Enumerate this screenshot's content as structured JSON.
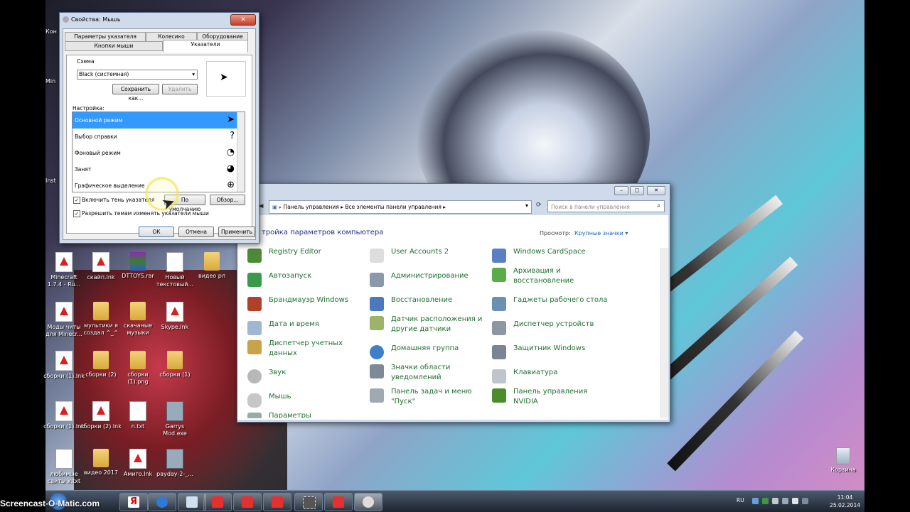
{
  "desktop": {
    "icons": [
      {
        "label": "Minecraft 1.7.4 - Ru...",
        "type": "pdf"
      },
      {
        "label": "скайп.lnk",
        "type": "pdf"
      },
      {
        "label": "DTTOYS.rar",
        "type": "rar"
      },
      {
        "label": "Новый текстовый...",
        "type": "txt"
      },
      {
        "label": "видео рл",
        "type": "folder"
      },
      {
        "label": "Моды читы для Minecr...",
        "type": "pdf"
      },
      {
        "label": "мультики я создал ^_^",
        "type": "folder"
      },
      {
        "label": "скачаные музыки",
        "type": "folder"
      },
      {
        "label": "Skype.lnk",
        "type": "pdf"
      },
      {
        "label": "сборки (1).lnk",
        "type": "pdf"
      },
      {
        "label": "сборки (2)",
        "type": "folder"
      },
      {
        "label": "сборки (1).png",
        "type": "folder"
      },
      {
        "label": "сборки (1)",
        "type": "folder"
      },
      {
        "label": "сборки (1).lnk",
        "type": "pdf"
      },
      {
        "label": "сборки (2).lnk",
        "type": "pdf"
      },
      {
        "label": "n.txt",
        "type": "txt"
      },
      {
        "label": "Garrys Mod.exe",
        "type": "exe"
      },
      {
        "label": "любимые сайты x.txt",
        "type": "txt"
      },
      {
        "label": "видео 2017",
        "type": "folder"
      },
      {
        "label": "Амиго.lnk",
        "type": "pdf"
      },
      {
        "label": "payday-2-_...",
        "type": "exe"
      }
    ],
    "partial_labels": {
      "kon": "Кон",
      "min": "Min",
      "inst": "Inst"
    },
    "recycle_bin": "Корзина"
  },
  "mouse_dialog": {
    "title": "Свойства: Мышь",
    "close": "✕",
    "tabs_top": [
      "Параметры указателя",
      "Колесико",
      "Оборудование"
    ],
    "tabs_bottom": [
      "Кнопки мыши",
      "Указатели"
    ],
    "scheme_group": "Схема",
    "scheme_value": "Black (системная)",
    "save_as": "Сохранить как...",
    "delete": "Удалить",
    "customize_label": "Настройка:",
    "list_items": [
      {
        "label": "Основной режим",
        "cursor": "➤"
      },
      {
        "label": "Выбор справки",
        "cursor": "?"
      },
      {
        "label": "Фоновый режим",
        "cursor": "◔"
      },
      {
        "label": "Занят",
        "cursor": "◕"
      },
      {
        "label": "Графическое выделение",
        "cursor": "⊕"
      }
    ],
    "enable_shadow": "Включить тень указателя",
    "default_btn": "По умолчанию",
    "browse_btn": "Обзор...",
    "allow_themes": "Разрешить темам изменять указатели мыши",
    "ok": "ОК",
    "cancel": "Отмена",
    "apply": "Применить"
  },
  "control_panel": {
    "breadcrumb": [
      "Панель управления",
      "Все элементы панели управления"
    ],
    "search_placeholder": "Поиск в панели управления",
    "heading": "тройка параметров компьютера",
    "view_label": "Просмотр:",
    "view_value": "Крупные значки ▾",
    "items": [
      [
        "Registry Editor",
        "User Accounts 2",
        "Windows CardSpace"
      ],
      [
        "Автозапуск",
        "Администрирование",
        "Архивация и восстановление"
      ],
      [
        "Брандмауэр Windows",
        "Восстановление",
        "Гаджеты рабочего стола"
      ],
      [
        "Дата и время",
        "Датчик расположения и другие датчики",
        "Диспетчер устройств"
      ],
      [
        "Диспетчер учетных данных",
        "Домашняя группа",
        "Защитник Windows"
      ],
      [
        "Звук",
        "Значки области уведомлений",
        "Клавиатура"
      ],
      [
        "Мышь",
        "Панель задач и меню \"Пуск\"",
        "Панель управления NVIDIA"
      ],
      [
        "Параметры",
        "",
        ""
      ]
    ]
  },
  "taskbar": {
    "watermark": "Screencast-O-Matic.com",
    "lang": "RU",
    "time": "11:04",
    "date": "25.02.2014"
  }
}
